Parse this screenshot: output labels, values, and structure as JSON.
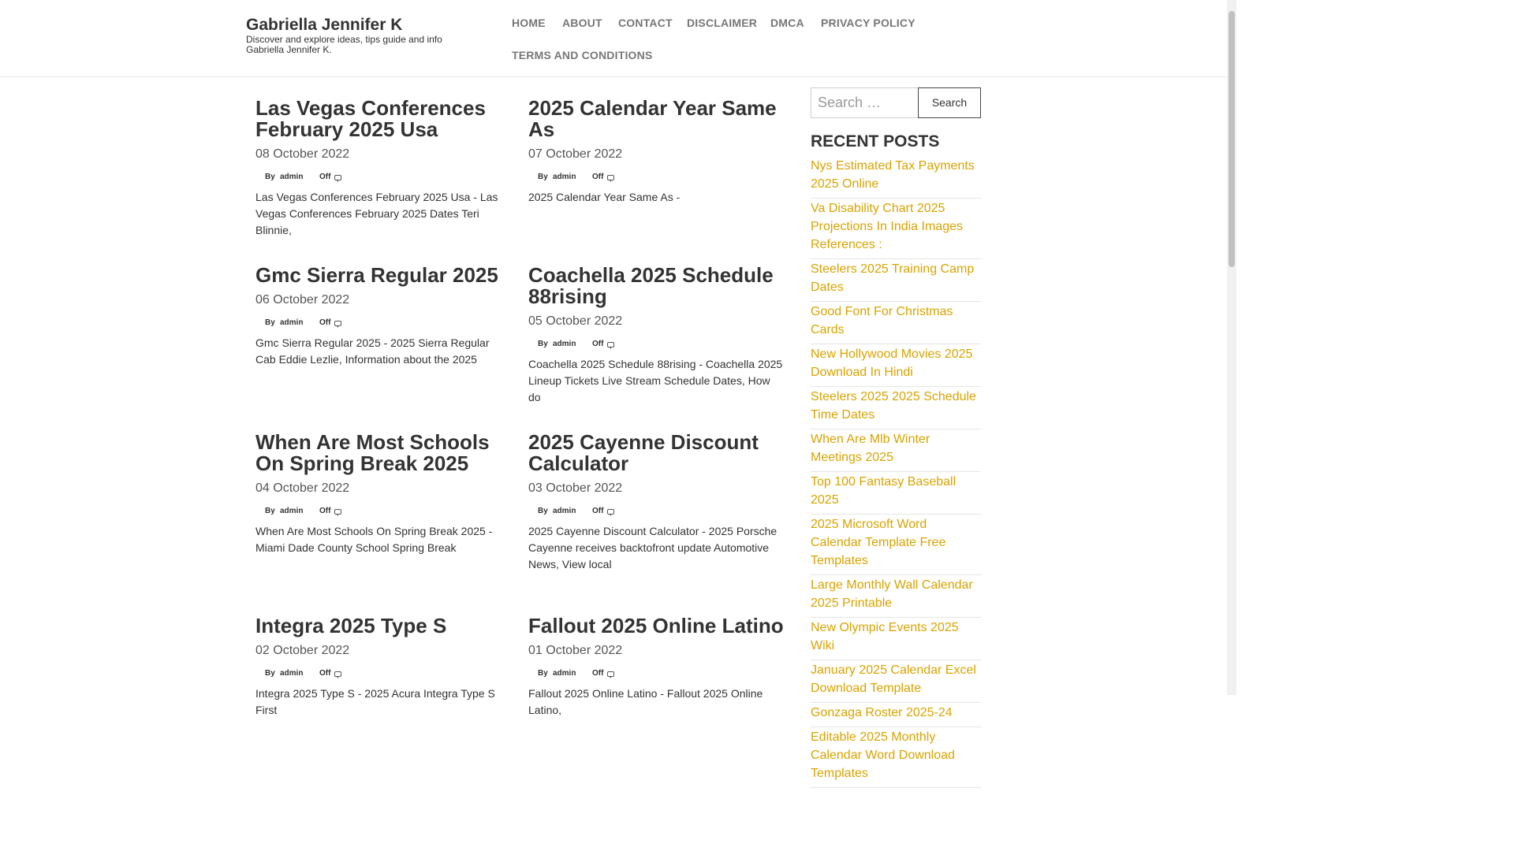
{
  "site": {
    "title": "Gabriella Jennifer K",
    "description": "Discover and explore ideas, tips guide and info Gabriella Jennifer K."
  },
  "nav": {
    "items": [
      "HOME",
      "ABOUT",
      "CONTACT",
      "DISCLAIMER",
      "DMCA",
      "PRIVACY POLICY",
      "TERMS AND CONDITIONS"
    ]
  },
  "posts": [
    {
      "title": "Las Vegas Conferences February 2025 Usa",
      "date": "08 October 2022",
      "by": "By",
      "author": "admin",
      "comments": "Off",
      "excerpt": "Las Vegas Conferences February 2025 Usa - Las Vegas Conferences February 2025 Dates Teri Blinnie,"
    },
    {
      "title": "2025 Calendar Year Same As",
      "date": "07 October 2022",
      "by": "By",
      "author": "admin",
      "comments": "Off",
      "excerpt": "2025 Calendar Year Same As -"
    },
    {
      "title": "Gmc Sierra Regular 2025",
      "date": "06 October 2022",
      "by": "By",
      "author": "admin",
      "comments": "Off",
      "excerpt": "Gmc Sierra Regular 2025 - 2025 Sierra Regular Cab Eddie Lezlie, Information about the 2025"
    },
    {
      "title": "Coachella 2025 Schedule 88rising",
      "date": "05 October 2022",
      "by": "By",
      "author": "admin",
      "comments": "Off",
      "excerpt": "Coachella 2025 Schedule 88rising - Coachella 2025 Lineup Tickets Live Stream Schedule Dates, How do"
    },
    {
      "title": "When Are Most Schools On Spring Break 2025",
      "date": "04 October 2022",
      "by": "By",
      "author": "admin",
      "comments": "Off",
      "excerpt": "When Are Most Schools On Spring Break 2025 - Miami Dade County School Spring Break"
    },
    {
      "title": "2025 Cayenne Discount Calculator",
      "date": "03 October 2022",
      "by": "By",
      "author": "admin",
      "comments": "Off",
      "excerpt": "2025 Cayenne Discount Calculator - 2025 Porsche Cayenne receives backtofront update Automotive News, View local"
    },
    {
      "title": "Integra 2025 Type S",
      "date": "02 October 2022",
      "by": "By",
      "author": "admin",
      "comments": "Off",
      "excerpt": "Integra 2025 Type S - 2025 Acura Integra Type S First"
    },
    {
      "title": "Fallout 2025 Online Latino",
      "date": "01 October 2022",
      "by": "By",
      "author": "admin",
      "comments": "Off",
      "excerpt": "Fallout 2025 Online Latino - Fallout 2025 Online Latino,"
    }
  ],
  "search": {
    "placeholder": "Search …",
    "button_label": "Search"
  },
  "recent_posts": {
    "heading": "RECENT POSTS",
    "items": [
      "Nys Estimated Tax Payments 2025 Online",
      "Va Disability Chart 2025 Projections In India Images References :",
      "Steelers 2025 Training Camp Dates",
      "Good Font For Christmas Cards",
      "New Hollywood Movies 2025 Download In Hindi",
      "Steelers 2025 2025 Schedule Time Dates",
      "When Are Mlb Winter Meetings 2025",
      "Top 100 Fantasy Baseball 2025",
      "2025 Microsoft Word Calendar Template Free Templates",
      "Large Monthly Wall Calendar 2025 Printable",
      "New Olympic Events 2025 Wiki",
      "January 2025 Calendar Excel Download Template",
      "Gonzaga Roster 2025-24",
      "Editable 2025 Monthly Calendar Word Download Templates"
    ]
  },
  "colors": {
    "accent": "#d9a300",
    "nav_text": "#777777",
    "heading_text": "#333333"
  }
}
